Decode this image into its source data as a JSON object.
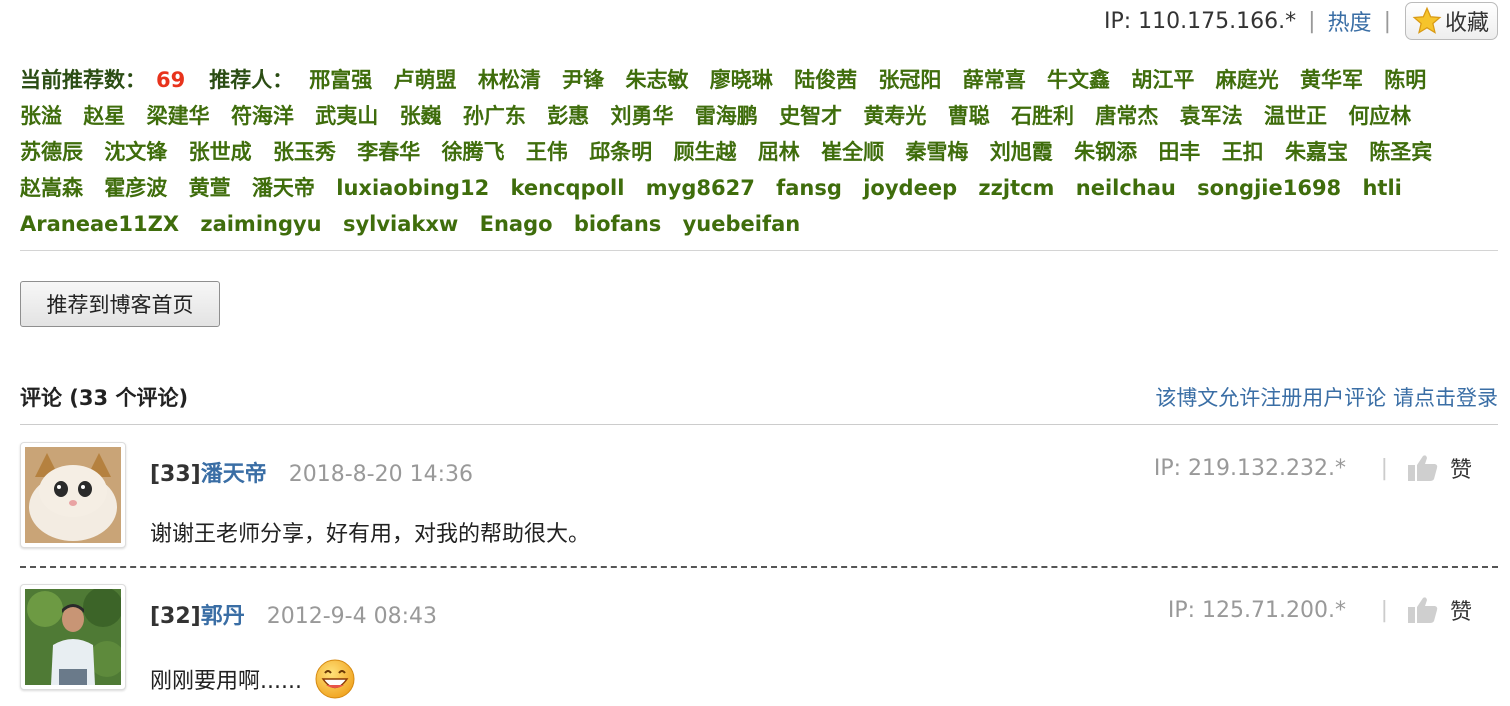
{
  "topbar": {
    "ip": "IP: 110.175.166.*",
    "separator": "|",
    "heat": "热度",
    "sep2": "|",
    "favorite": "收藏"
  },
  "recommend": {
    "label": "当前推荐数：",
    "count": "69",
    "people_label": "推荐人：",
    "people": [
      "邢富强",
      "卢萌盟",
      "林松清",
      "尹锋",
      "朱志敏",
      "廖晓琳",
      "陆俊茜",
      "张冠阳",
      "薛常喜",
      "牛文鑫",
      "胡江平",
      "麻庭光",
      "黄华军",
      "陈明",
      "张溢",
      "赵星",
      "梁建华",
      "符海洋",
      "武夷山",
      "张巍",
      "孙广东",
      "彭惠",
      "刘勇华",
      "雷海鹏",
      "史智才",
      "黄寿光",
      "曹聪",
      "石胜利",
      "唐常杰",
      "袁军法",
      "温世正",
      "何应林",
      "苏德辰",
      "沈文锋",
      "张世成",
      "张玉秀",
      "李春华",
      "徐腾飞",
      "王伟",
      "邱条明",
      "顾生越",
      "屈林",
      "崔全顺",
      "秦雪梅",
      "刘旭霞",
      "朱钢添",
      "田丰",
      "王扣",
      "朱嘉宝",
      "陈圣宾",
      "赵嵩森",
      "霍彦波",
      "黄萱",
      "潘天帝",
      "luxiaobing12",
      "kencqpoll",
      "myg8627",
      "fansg",
      "joydeep",
      "zzjtcm",
      "neilchau",
      "songjie1698",
      "htli",
      "Araneae11ZX",
      "zaimingyu",
      "sylviakxw",
      "Enago",
      "biofans",
      "yuebeifan"
    ]
  },
  "recommend_button": "推荐到博客首页",
  "comments_section": {
    "title": "评论 (33 个评论)",
    "login_note": "该博文允许注册用户评论 请点击登录"
  },
  "comments": [
    {
      "num": "[33]",
      "author": "潘天帝",
      "date": "2018-8-20 14:36",
      "ip": "IP: 219.132.232.*",
      "bar": "|",
      "like": "赞",
      "text": "谢谢王老师分享，好有用，对我的帮助很大。",
      "avatar_icon": "cat-avatar-icon"
    },
    {
      "num": "[32]",
      "author": "郭丹",
      "date": "2012-9-4 08:43",
      "ip": "IP: 125.71.200.*",
      "bar": "|",
      "like": "赞",
      "text": "刚刚要用啊......",
      "avatar_icon": "person-avatar-icon",
      "emoji": "grin-emoji-icon"
    }
  ],
  "colors": {
    "recommender_green": "#3f6d0c",
    "count_red": "#e8331c",
    "link_blue": "#3a6ea5"
  }
}
